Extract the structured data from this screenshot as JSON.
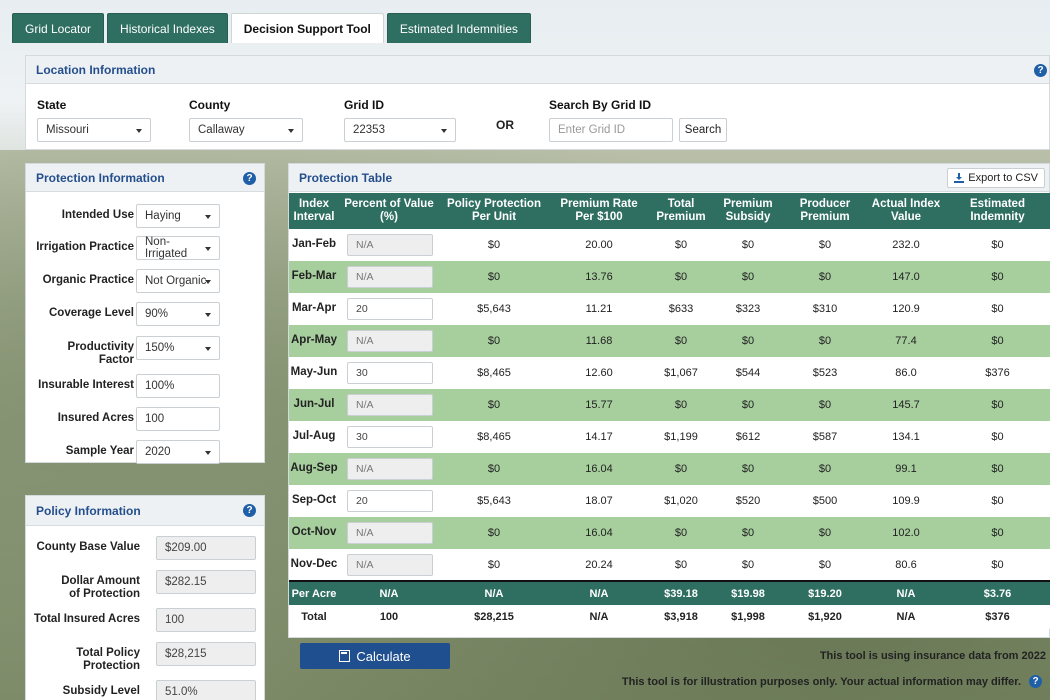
{
  "tabs": [
    "Grid Locator",
    "Historical Indexes",
    "Decision Support Tool",
    "Estimated Indemnities"
  ],
  "location": {
    "title": "Location Information",
    "state_label": "State",
    "state_value": "Missouri",
    "county_label": "County",
    "county_value": "Callaway",
    "grid_label": "Grid ID",
    "grid_value": "22353",
    "or_text": "OR",
    "search_label": "Search By Grid ID",
    "search_placeholder": "Enter Grid ID",
    "search_button": "Search"
  },
  "protection": {
    "title": "Protection Information",
    "fields": [
      {
        "label": "Intended Use",
        "value": "Haying",
        "type": "select"
      },
      {
        "label": "Irrigation Practice",
        "value": "Non-Irrigated",
        "type": "select"
      },
      {
        "label": "Organic Practice",
        "value": "Not Organic",
        "type": "select"
      },
      {
        "label": "Coverage Level",
        "value": "90%",
        "type": "select"
      },
      {
        "label": "Productivity Factor",
        "value": "150%",
        "type": "select"
      },
      {
        "label": "Insurable Interest",
        "value": "100%",
        "type": "input"
      },
      {
        "label": "Insured Acres",
        "value": "100",
        "type": "input"
      },
      {
        "label": "Sample Year",
        "value": "2020",
        "type": "select"
      }
    ]
  },
  "policy": {
    "title": "Policy Information",
    "fields": [
      {
        "label": "County Base Value",
        "value": "$209.00"
      },
      {
        "label": "Dollar Amount of Protection",
        "value": "$282.15"
      },
      {
        "label": "Total Insured Acres",
        "value": "100"
      },
      {
        "label": "Total Policy Protection",
        "value": "$28,215"
      },
      {
        "label": "Subsidy Level",
        "value": "51.0%"
      }
    ]
  },
  "table": {
    "title": "Protection Table",
    "export_label": "Export to CSV",
    "headers": [
      "Index Interval",
      "Percent of Value (%)",
      "Policy Protection Per Unit",
      "Premium Rate Per $100",
      "Total Premium",
      "Premium Subsidy",
      "Producer Premium",
      "Actual Index Value",
      "Estimated Indemnity"
    ],
    "rows": [
      {
        "interval": "Jan-Feb",
        "pct": "N/A",
        "ppu": "$0",
        "rate": "20.00",
        "total": "$0",
        "subsidy": "$0",
        "producer": "$0",
        "index": "232.0",
        "indemnity": "$0"
      },
      {
        "interval": "Feb-Mar",
        "pct": "N/A",
        "ppu": "$0",
        "rate": "13.76",
        "total": "$0",
        "subsidy": "$0",
        "producer": "$0",
        "index": "147.0",
        "indemnity": "$0"
      },
      {
        "interval": "Mar-Apr",
        "pct": "20",
        "ppu": "$5,643",
        "rate": "11.21",
        "total": "$633",
        "subsidy": "$323",
        "producer": "$310",
        "index": "120.9",
        "indemnity": "$0"
      },
      {
        "interval": "Apr-May",
        "pct": "N/A",
        "ppu": "$0",
        "rate": "11.68",
        "total": "$0",
        "subsidy": "$0",
        "producer": "$0",
        "index": "77.4",
        "indemnity": "$0"
      },
      {
        "interval": "May-Jun",
        "pct": "30",
        "ppu": "$8,465",
        "rate": "12.60",
        "total": "$1,067",
        "subsidy": "$544",
        "producer": "$523",
        "index": "86.0",
        "indemnity": "$376"
      },
      {
        "interval": "Jun-Jul",
        "pct": "N/A",
        "ppu": "$0",
        "rate": "15.77",
        "total": "$0",
        "subsidy": "$0",
        "producer": "$0",
        "index": "145.7",
        "indemnity": "$0"
      },
      {
        "interval": "Jul-Aug",
        "pct": "30",
        "ppu": "$8,465",
        "rate": "14.17",
        "total": "$1,199",
        "subsidy": "$612",
        "producer": "$587",
        "index": "134.1",
        "indemnity": "$0"
      },
      {
        "interval": "Aug-Sep",
        "pct": "N/A",
        "ppu": "$0",
        "rate": "16.04",
        "total": "$0",
        "subsidy": "$0",
        "producer": "$0",
        "index": "99.1",
        "indemnity": "$0"
      },
      {
        "interval": "Sep-Oct",
        "pct": "20",
        "ppu": "$5,643",
        "rate": "18.07",
        "total": "$1,020",
        "subsidy": "$520",
        "producer": "$500",
        "index": "109.9",
        "indemnity": "$0"
      },
      {
        "interval": "Oct-Nov",
        "pct": "N/A",
        "ppu": "$0",
        "rate": "16.04",
        "total": "$0",
        "subsidy": "$0",
        "producer": "$0",
        "index": "102.0",
        "indemnity": "$0"
      },
      {
        "interval": "Nov-Dec",
        "pct": "N/A",
        "ppu": "$0",
        "rate": "20.24",
        "total": "$0",
        "subsidy": "$0",
        "producer": "$0",
        "index": "80.6",
        "indemnity": "$0"
      }
    ],
    "per_acre": [
      "Per Acre",
      "N/A",
      "N/A",
      "N/A",
      "$39.18",
      "$19.98",
      "$19.20",
      "N/A",
      "$3.76"
    ],
    "total": [
      "Total",
      "100",
      "$28,215",
      "N/A",
      "$3,918",
      "$1,998",
      "$1,920",
      "N/A",
      "$376"
    ]
  },
  "calculate_label": "Calculate",
  "note_data": "This tool is using insurance data from 2022",
  "note_disclaimer": "This tool is for illustration purposes only. Your actual information may differ.",
  "colors": {
    "tab_green": "#2f6f62",
    "row_green": "#a7cf9e",
    "title_blue": "#244f8c",
    "button_blue": "#1f4f8f"
  }
}
